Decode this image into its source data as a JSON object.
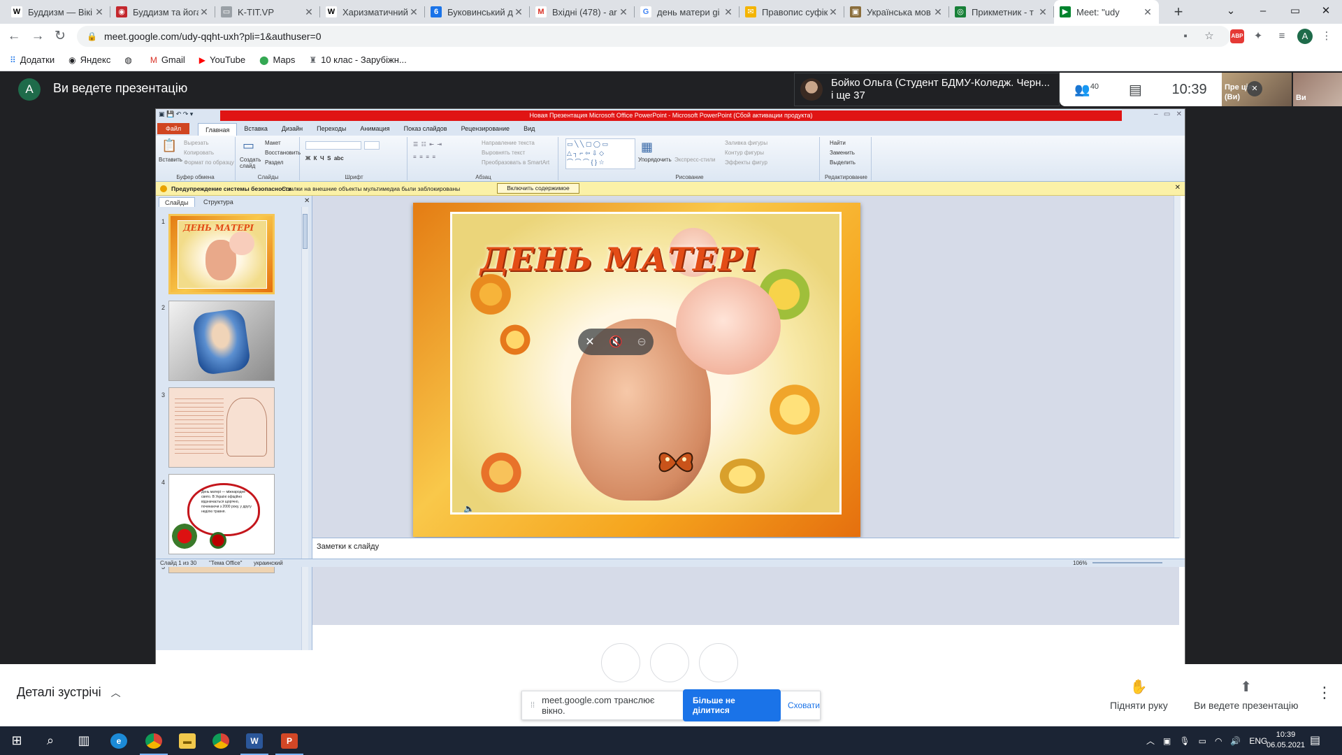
{
  "browser": {
    "tabs": [
      {
        "title": "Буддизм — Вікі",
        "icon": "W",
        "color": "#ffffff",
        "fg": "#000"
      },
      {
        "title": "Буддизм та йога",
        "icon": "◉",
        "color": "#c3272d",
        "fg": "#fff"
      },
      {
        "title": "K-TIT.VP",
        "icon": "▭",
        "color": "#9aa0a6",
        "fg": "#fff"
      },
      {
        "title": "Харизматичний",
        "icon": "W",
        "color": "#ffffff",
        "fg": "#000"
      },
      {
        "title": "Буковинський д",
        "icon": "6",
        "color": "#1a73e8",
        "fg": "#fff"
      },
      {
        "title": "Вхідні (478) - ar",
        "icon": "M",
        "color": "#ffffff",
        "fg": "#d93025"
      },
      {
        "title": "день матери gi",
        "icon": "G",
        "color": "#ffffff",
        "fg": "#4285f4"
      },
      {
        "title": "Правопис суфік",
        "icon": "✉",
        "color": "#f4b400",
        "fg": "#fff"
      },
      {
        "title": "Українська мов",
        "icon": "▣",
        "color": "#8a6d3b",
        "fg": "#fff"
      },
      {
        "title": "Прикметник - т",
        "icon": "◎",
        "color": "#188038",
        "fg": "#fff"
      },
      {
        "title": "Meet: \"udy",
        "icon": "▶",
        "color": "#00832d",
        "fg": "#fff",
        "active": true
      }
    ],
    "url": "meet.google.com/udy-qqht-uxh?pli=1&authuser=0",
    "profile_initial": "A",
    "abp_label": "ABP",
    "bookmarks": [
      {
        "label": "Додатки",
        "icon": "apps-icon"
      },
      {
        "label": "Яндекс",
        "icon": "yandex-icon"
      },
      {
        "label": "",
        "icon": "globe-icon"
      },
      {
        "label": "Gmail",
        "icon": "gmail-icon"
      },
      {
        "label": "YouTube",
        "icon": "youtube-icon"
      },
      {
        "label": "Maps",
        "icon": "maps-icon"
      },
      {
        "label": "10 клас - Зарубіжн...",
        "icon": "school-icon"
      }
    ]
  },
  "meet": {
    "presenter_initial": "A",
    "presenting_text": "Ви ведете презентацію",
    "speaker_line1": "Бойко Ольга (Студент БДМУ-Коледж. Черн...",
    "speaker_line2": "і ще 37",
    "participants_count": "40",
    "clock": "10:39",
    "self_tile_label_1": "Пре",
    "self_tile_label_2": "(Ви)",
    "self_tile_label_3": "ція",
    "remote_tile_label": "Ви",
    "details_label": "Деталі зустрічі",
    "share_banner_text": "meet.google.com транслює вікно.",
    "stop_share_label": "Більше не ділитися",
    "hide_label": "Сховати",
    "raise_hand_label": "Підняти руку",
    "presenting_label": "Ви ведете презентацію"
  },
  "ppt": {
    "window_title": "Новая Презентация Microsoft Office PowerPoint - Microsoft PowerPoint (Сбой активации продукта)",
    "file_tab": "Файл",
    "tabs": [
      "Главная",
      "Вставка",
      "Дизайн",
      "Переходы",
      "Анимация",
      "Показ слайдов",
      "Рецензирование",
      "Вид"
    ],
    "clipboard": {
      "paste": "Вставить",
      "cut": "Вырезать",
      "copy": "Копировать",
      "format": "Формат по образцу",
      "label": "Буфер обмена"
    },
    "slides_group": {
      "new": "Создать слайд",
      "layout": "Макет",
      "reset": "Восстановить",
      "section": "Раздел",
      "label": "Слайды"
    },
    "font_label": "Шрифт",
    "paragraph": {
      "direction": "Направление текста",
      "align": "Выровнять текст",
      "smartart": "Преобразовать в SmartArt",
      "label": "Абзац"
    },
    "drawing": {
      "arrange": "Упорядочить",
      "styles": "Экспресс-стили",
      "fill": "Заливка фигуры",
      "outline": "Контур фигуры",
      "effects": "Эффекты фигур",
      "label": "Рисование"
    },
    "editing": {
      "find": "Найти",
      "replace": "Заменить",
      "select": "Выделить",
      "label": "Редактирование"
    },
    "security_title": "Предупреждение системы безопасности",
    "security_text": "Ссылки на внешние объекты мультимедиа были заблокированы",
    "security_button": "Включить содержимое",
    "panel_tabs": [
      "Слайды",
      "Структура"
    ],
    "slide_title": "ДЕНЬ МАТЕРІ",
    "thumb4_text": "День матері — міжнародне свято. В Україні офіційно відзначається щорічно, починаючи з 2000 року, у другу неділю травня.",
    "notes_placeholder": "Заметки к слайду",
    "status": {
      "slide": "Слайд 1 из 30",
      "theme": "\"Тема Office\"",
      "lang": "украинский",
      "zoom": "106%"
    }
  },
  "taskbar": {
    "lang": "ENG",
    "time": "10:39",
    "date": "06.05.2021"
  }
}
